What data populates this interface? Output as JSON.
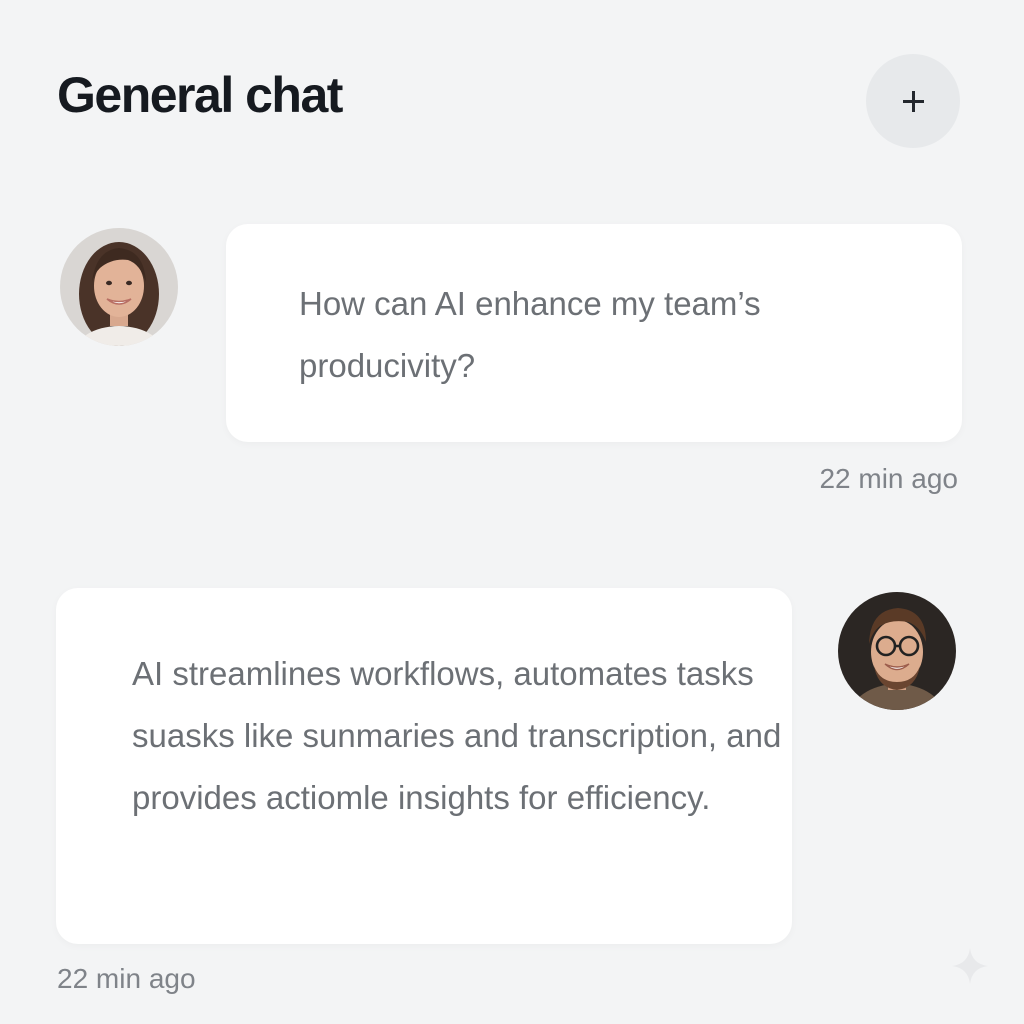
{
  "header": {
    "title": "General chat",
    "add_label": "+"
  },
  "messages": [
    {
      "sender": "user",
      "avatar": "woman-avatar",
      "text": "How can AI enhance my team’s producivity?",
      "time": "22 min ago"
    },
    {
      "sender": "assistant",
      "avatar": "man-avatar",
      "text": "AI streamlines workflows, automates tasks suasks like sunmaries and transcription, and provides actiomle insights for efficiency.",
      "time": "22 min ago"
    }
  ],
  "colors": {
    "background": "#f3f4f5",
    "bubble": "#ffffff",
    "title": "#161a20",
    "message_text": "#6c7075",
    "timestamp": "#7f8389",
    "add_button": "#e7e9eb"
  }
}
